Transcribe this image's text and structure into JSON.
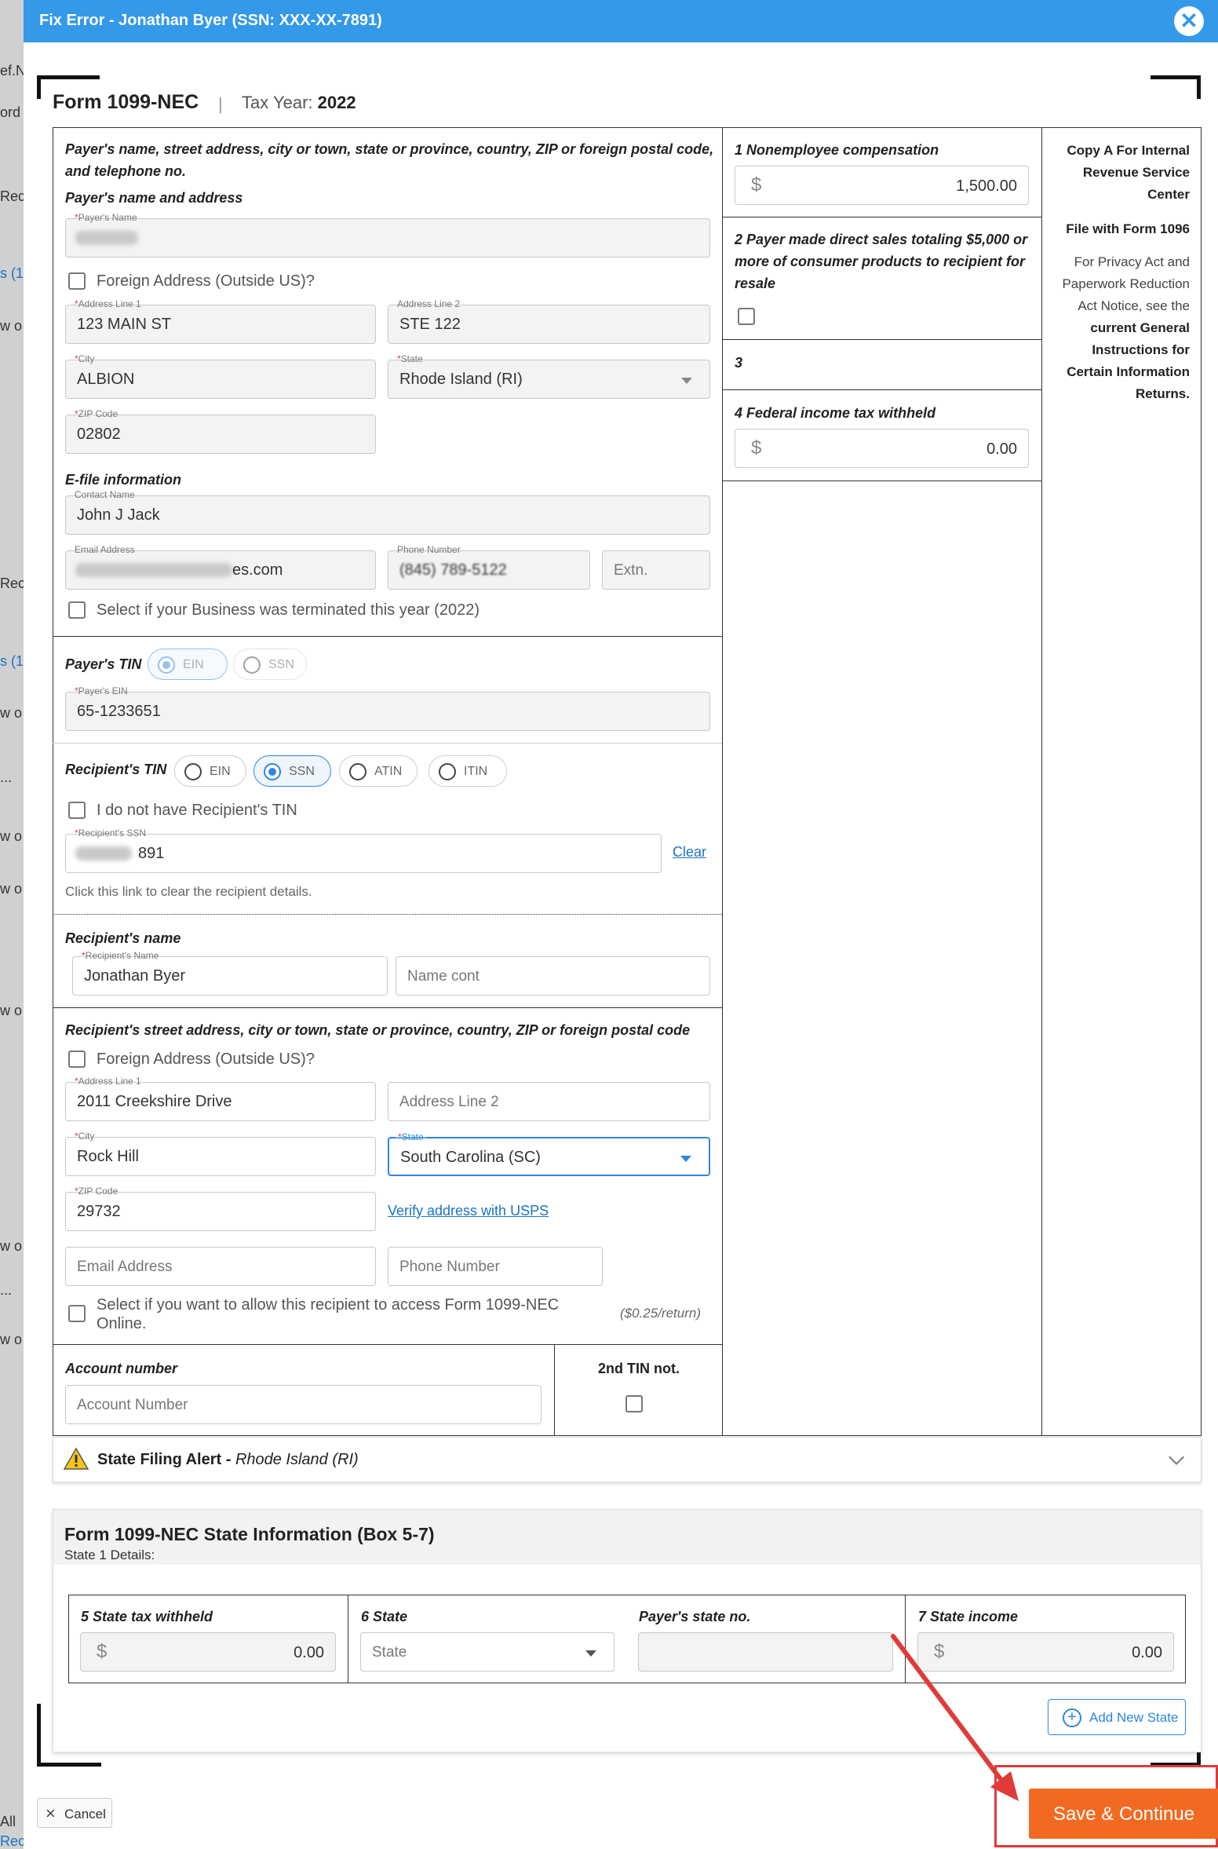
{
  "background_page": {
    "fragments": [
      "ef.N",
      "ord",
      "Reci",
      "s (1",
      "w o",
      "Reci",
      "s (1",
      "w o",
      "...",
      "w o",
      "w o",
      "w o",
      "w o",
      "...",
      "w o",
      "All",
      "Rec"
    ]
  },
  "modal": {
    "title": "Fix Error - Jonathan Byer (SSN: XXX-XX-7891)",
    "close_glyph": "✕"
  },
  "form": {
    "name": "Form 1099-NEC",
    "separator": "|",
    "tax_year_label": "Tax Year:",
    "tax_year": "2022"
  },
  "payer": {
    "section_label": "Payer's name, street address, city or town, state or province, country, ZIP or foreign postal code, and telephone no.",
    "name_address_label": "Payer's name and address",
    "name_label": "Payer's Name",
    "foreign_address_label": "Foreign Address (Outside US)?",
    "address1_label": "Address Line 1",
    "address1": "123 MAIN ST",
    "address2_label": "Address Line 2",
    "address2": "STE 122",
    "city_label": "City",
    "city": "ALBION",
    "state_label": "State",
    "state": "Rhode Island (RI)",
    "zip_label": "ZIP Code",
    "zip": "02802",
    "efile_label": "E-file information",
    "contact_label": "Contact Name",
    "contact": "John J Jack",
    "email_label": "Email Address",
    "email_visible": "es.com",
    "phone_label": "Phone Number",
    "phone_visible": "(845) 789-5122",
    "extn_placeholder": "Extn.",
    "terminated_label": "Select if your Business was terminated this year (2022)",
    "tin_label": "Payer's TIN",
    "tin_options": [
      "EIN",
      "SSN"
    ],
    "ein_label": "Payer's EIN",
    "ein": "65-1233651"
  },
  "recipient": {
    "tin_label": "Recipient's TIN",
    "tin_options": [
      "EIN",
      "SSN",
      "ATIN",
      "ITIN"
    ],
    "tin_selected": "SSN",
    "no_tin_label": "I do not have Recipient's TIN",
    "ssn_label": "Recipient's SSN",
    "ssn_visible": "891",
    "clear_link": "Clear",
    "clear_hint": "Click this link to clear the recipient details.",
    "name_section_label": "Recipient's name",
    "name_label": "Recipient's Name",
    "name": "Jonathan Byer",
    "name_cont_placeholder": "Name cont",
    "address_section_label": "Recipient's street address, city or town, state or province, country, ZIP or foreign postal code",
    "foreign_address_label": "Foreign Address (Outside US)?",
    "address1_label": "Address Line 1",
    "address1": "2011 Creekshire Drive",
    "address2_placeholder": "Address Line 2",
    "city_label": "City",
    "city": "Rock Hill",
    "state_label": "State",
    "state": "South Carolina (SC)",
    "zip_label": "ZIP Code",
    "zip": "29732",
    "verify_link": "Verify address with USPS",
    "email_placeholder": "Email Address",
    "phone_placeholder": "Phone Number",
    "online_access_label": "Select if you want to allow this recipient to access Form 1099-NEC Online.",
    "online_access_price": "($0.25/return)",
    "account_label": "Account number",
    "account_placeholder": "Account Number",
    "second_tin_label": "2nd TIN not."
  },
  "boxes": {
    "box1_label": "1 Nonemployee compensation",
    "box1_value": "1,500.00",
    "box2_label": "2 Payer made direct sales totaling $5,000 or more of consumer products to recipient for resale",
    "box3_label": "3",
    "box4_label": "4 Federal income tax withheld",
    "box4_value": "0.00",
    "currency": "$"
  },
  "copy_info": {
    "copy_a": "Copy A For Internal Revenue Service Center",
    "file_with": "File with Form 1096",
    "privacy_prefix": "For Privacy Act and Paperwork Reduction Act Notice, see the",
    "privacy_bold": "current General Instructions for Certain Information Returns."
  },
  "state_alert": {
    "label": "State Filing Alert - ",
    "state": "Rhode Island (RI)"
  },
  "state_info": {
    "title": "Form 1099-NEC State Information (Box 5-7)",
    "subtitle": "State 1 Details:",
    "box5_label": "5 State tax withheld",
    "box5_value": "0.00",
    "box6_label": "6 State",
    "box6_placeholder": "State",
    "payer_state_no_label": "Payer's state no.",
    "box7_label": "7 State income",
    "box7_value": "0.00",
    "add_state_label": "Add New State"
  },
  "footer": {
    "cancel_label": "Cancel",
    "save_label": "Save & Continue"
  },
  "colors": {
    "header_blue": "#3399e8",
    "save_orange": "#f26a21",
    "annotation_red": "#e03a3a",
    "link_blue": "#1a73c8"
  }
}
